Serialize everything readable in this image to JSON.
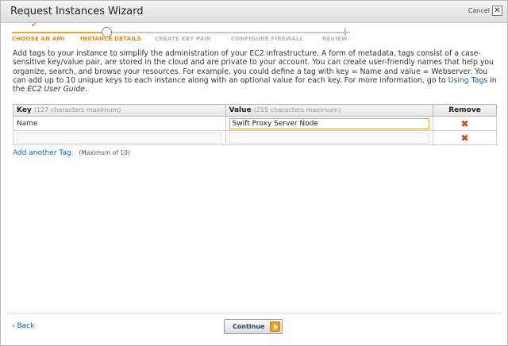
{
  "window": {
    "title": "Request Instances Wizard",
    "cancel_label": "Cancel",
    "close_glyph": "✕"
  },
  "steps": [
    {
      "label": "CHOOSE AN AMI",
      "state": "done"
    },
    {
      "label": "INSTANCE DETAILS",
      "state": "current"
    },
    {
      "label": "CREATE KEY PAIR",
      "state": "todo"
    },
    {
      "label": "CONFIGURE FIREWALL",
      "state": "todo"
    },
    {
      "label": "REVIEW",
      "state": "todo"
    }
  ],
  "step_check_glyph": "✔",
  "description": {
    "part1": "Add tags to your instance to simplify the administration of your EC2 infrastructure. A form of metadata, tags consist of a case-sensitive key/value pair, are stored in the cloud and are private to your account. You can create user-friendly names that help you organize, search, and browse your resources. For example, you could define a tag with key = Name and value = Webserver. You can add up to 10 unique keys to each instance along with an optional value for each key. For more information, go to ",
    "link": "Using Tags",
    "part2": " in the ",
    "guide": "EC2 User Guide",
    "part3": "."
  },
  "table": {
    "headers": {
      "key": "Key",
      "key_hint": "(127 characters maximum)",
      "value": "Value",
      "value_hint": "(255 characters maximum)",
      "remove": "Remove"
    },
    "rows": [
      {
        "key": "Name",
        "value": "Swift Proxy Server Node"
      },
      {
        "key": "",
        "value": ""
      }
    ],
    "remove_glyph": "✖"
  },
  "add_tag": {
    "label": "Add another Tag.",
    "max_note": "(Maximum of 10)"
  },
  "footer": {
    "back_label": "‹ Back",
    "continue_label": "Continue"
  },
  "colors": {
    "accent_orange": "#f0a030",
    "link_blue": "#1a62a8",
    "remove_red": "#d8441a"
  },
  "icons": [
    "close-icon",
    "checkmark-icon",
    "remove-icon",
    "arrow-right-icon"
  ]
}
